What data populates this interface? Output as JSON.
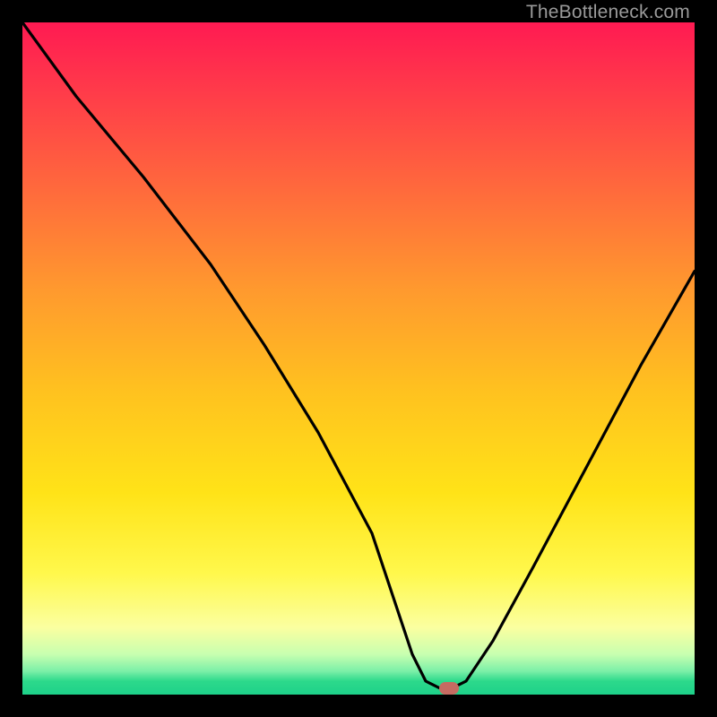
{
  "attribution": "TheBottleneck.com",
  "chart_data": {
    "type": "line",
    "title": "",
    "xlabel": "",
    "ylabel": "",
    "xlim": [
      0,
      100
    ],
    "ylim": [
      0,
      100
    ],
    "series": [
      {
        "name": "bottleneck-curve",
        "x": [
          0,
          8,
          18,
          28,
          36,
          44,
          52,
          58,
          60,
          62,
          64,
          66,
          70,
          76,
          84,
          92,
          100
        ],
        "values": [
          100,
          89,
          77,
          64,
          52,
          39,
          24,
          6,
          2,
          1,
          1,
          2,
          8,
          19,
          34,
          49,
          63
        ]
      }
    ],
    "marker": {
      "x": 63.5,
      "y": 1
    },
    "gradient_stops": [
      {
        "pct": 0,
        "color": "#ff1a52"
      },
      {
        "pct": 25,
        "color": "#ff6a3c"
      },
      {
        "pct": 55,
        "color": "#ffc21f"
      },
      {
        "pct": 82,
        "color": "#fff84c"
      },
      {
        "pct": 96.5,
        "color": "#7cf0a8"
      },
      {
        "pct": 100,
        "color": "#1ed18a"
      }
    ]
  }
}
